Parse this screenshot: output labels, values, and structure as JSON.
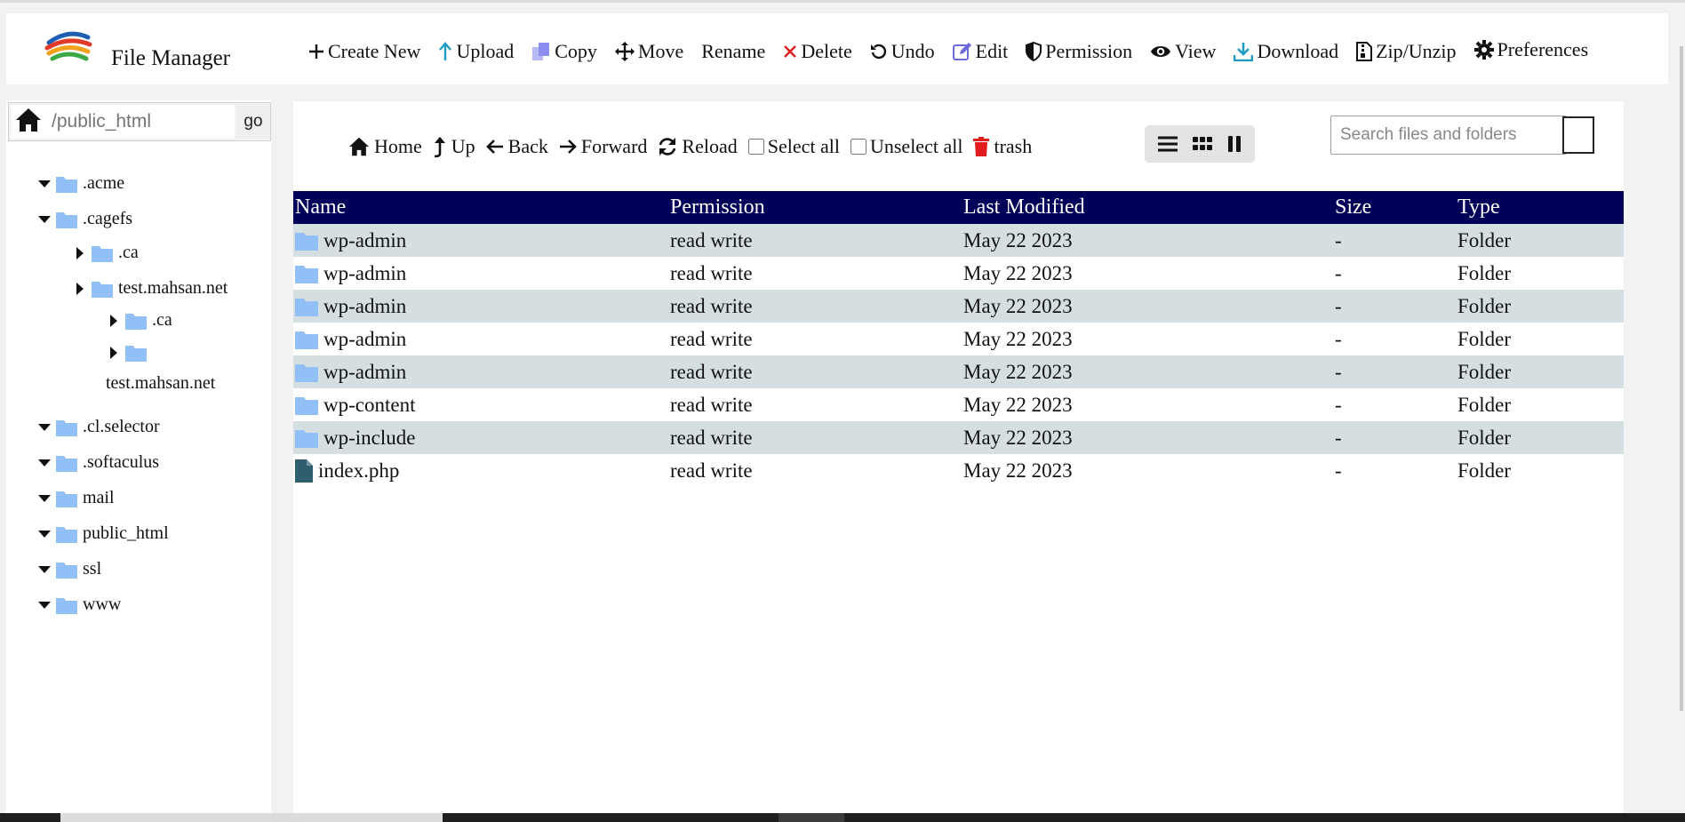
{
  "app": {
    "title": "File Manager"
  },
  "toolbar": {
    "create_new": "Create New",
    "upload": "Upload",
    "copy": "Copy",
    "move": "Move",
    "rename": "Rename",
    "delete": "Delete",
    "undo": "Undo",
    "edit": "Edit",
    "permission": "Permission",
    "view": "View",
    "download": "Download",
    "zip_unzip": "Zip/Unzip",
    "preferences": "Preferences"
  },
  "path": {
    "placeholder": "/public_html",
    "go_label": "go"
  },
  "tree": {
    "acme": ".acme",
    "cagefs": ".cagefs",
    "ca": ".ca",
    "test_mahsan": "test.mahsan.net",
    "ca2": ".ca",
    "test_mahsan2": "test.mahsan.net",
    "cl_selector": ".cl.selector",
    "softaculus": ".softaculus",
    "mail": "mail",
    "public_html": "public_html",
    "ssl": "ssl",
    "www": "www"
  },
  "nav": {
    "home": "Home",
    "up": "Up",
    "back": "Back",
    "forward": "Forward",
    "reload": "Reload",
    "select_all": "Select all",
    "unselect_all": "Unselect all",
    "trash": "trash"
  },
  "search": {
    "placeholder": "Search files and folders"
  },
  "table": {
    "headers": {
      "name": "Name",
      "permission": "Permission",
      "modified": "Last Modified",
      "size": "Size",
      "type": "Type"
    },
    "rows": [
      {
        "name": "wp-admin",
        "permission": "read write",
        "modified": "May 22 2023",
        "size": "-",
        "type": "Folder",
        "icon": "folder-icon"
      },
      {
        "name": "wp-admin",
        "permission": "read write",
        "modified": "May 22 2023",
        "size": "-",
        "type": "Folder",
        "icon": "folder-icon"
      },
      {
        "name": "wp-admin",
        "permission": "read write",
        "modified": "May 22 2023",
        "size": "-",
        "type": "Folder",
        "icon": "folder-icon"
      },
      {
        "name": "wp-admin",
        "permission": "read write",
        "modified": "May 22 2023",
        "size": "-",
        "type": "Folder",
        "icon": "folder-icon"
      },
      {
        "name": "wp-admin",
        "permission": "read write",
        "modified": "May 22 2023",
        "size": "-",
        "type": "Folder",
        "icon": "folder-icon"
      },
      {
        "name": "wp-content",
        "permission": "read write",
        "modified": "May 22 2023",
        "size": "-",
        "type": "Folder",
        "icon": "folder-icon"
      },
      {
        "name": "wp-include",
        "permission": "read write",
        "modified": "May 22 2023",
        "size": "-",
        "type": "Folder",
        "icon": "folder-icon"
      },
      {
        "name": "index.php",
        "permission": "read write",
        "modified": "May 22 2023",
        "size": "-",
        "type": "Folder",
        "icon": "file-icon"
      }
    ]
  },
  "colors": {
    "header_bg": "#000059",
    "row_alt": "#d5dfe2",
    "folder": "#92bff5",
    "file": "#2f5f6e",
    "delete": "#e11d1d",
    "trash": "#e11d1d",
    "upload": "#1f9cc4",
    "copy": "#8c8cf0",
    "edit": "#6a6adb"
  }
}
